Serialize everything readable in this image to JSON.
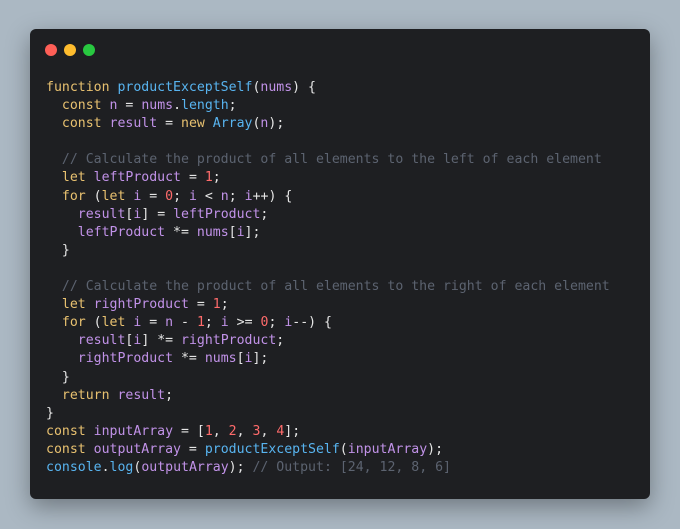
{
  "window": {
    "traffic_lights": [
      {
        "name": "close",
        "color": "#ff5f57"
      },
      {
        "name": "minimize",
        "color": "#febc2e"
      },
      {
        "name": "maximize",
        "color": "#28c840"
      }
    ]
  },
  "code": {
    "lines": [
      [
        [
          "kw",
          "function "
        ],
        [
          "fn",
          "productExceptSelf"
        ],
        [
          "pl",
          "("
        ],
        [
          "var",
          "nums"
        ],
        [
          "pl",
          ") {"
        ]
      ],
      [
        [
          "pl",
          "  "
        ],
        [
          "kw",
          "const "
        ],
        [
          "var",
          "n"
        ],
        [
          "pl",
          " = "
        ],
        [
          "var",
          "nums"
        ],
        [
          "pl",
          "."
        ],
        [
          "fn",
          "length"
        ],
        [
          "pl",
          ";"
        ]
      ],
      [
        [
          "pl",
          "  "
        ],
        [
          "kw",
          "const "
        ],
        [
          "var",
          "result"
        ],
        [
          "pl",
          " = "
        ],
        [
          "kw",
          "new "
        ],
        [
          "fn",
          "Array"
        ],
        [
          "pl",
          "("
        ],
        [
          "var",
          "n"
        ],
        [
          "pl",
          ");"
        ]
      ],
      [],
      [
        [
          "pl",
          "  "
        ],
        [
          "cm",
          "// Calculate the product of all elements to the left of each element"
        ]
      ],
      [
        [
          "pl",
          "  "
        ],
        [
          "kw",
          "let "
        ],
        [
          "var",
          "leftProduct"
        ],
        [
          "pl",
          " = "
        ],
        [
          "num",
          "1"
        ],
        [
          "pl",
          ";"
        ]
      ],
      [
        [
          "pl",
          "  "
        ],
        [
          "kw",
          "for "
        ],
        [
          "pl",
          "("
        ],
        [
          "kw",
          "let "
        ],
        [
          "var",
          "i"
        ],
        [
          "pl",
          " = "
        ],
        [
          "num",
          "0"
        ],
        [
          "pl",
          "; "
        ],
        [
          "var",
          "i"
        ],
        [
          "pl",
          " < "
        ],
        [
          "var",
          "n"
        ],
        [
          "pl",
          "; "
        ],
        [
          "var",
          "i"
        ],
        [
          "pl",
          "++) {"
        ]
      ],
      [
        [
          "pl",
          "    "
        ],
        [
          "var",
          "result"
        ],
        [
          "pl",
          "["
        ],
        [
          "var",
          "i"
        ],
        [
          "pl",
          "] = "
        ],
        [
          "var",
          "leftProduct"
        ],
        [
          "pl",
          ";"
        ]
      ],
      [
        [
          "pl",
          "    "
        ],
        [
          "var",
          "leftProduct"
        ],
        [
          "pl",
          " *= "
        ],
        [
          "var",
          "nums"
        ],
        [
          "pl",
          "["
        ],
        [
          "var",
          "i"
        ],
        [
          "pl",
          "];"
        ]
      ],
      [
        [
          "pl",
          "  }"
        ]
      ],
      [],
      [
        [
          "pl",
          "  "
        ],
        [
          "cm",
          "// Calculate the product of all elements to the right of each element"
        ]
      ],
      [
        [
          "pl",
          "  "
        ],
        [
          "kw",
          "let "
        ],
        [
          "var",
          "rightProduct"
        ],
        [
          "pl",
          " = "
        ],
        [
          "num",
          "1"
        ],
        [
          "pl",
          ";"
        ]
      ],
      [
        [
          "pl",
          "  "
        ],
        [
          "kw",
          "for "
        ],
        [
          "pl",
          "("
        ],
        [
          "kw",
          "let "
        ],
        [
          "var",
          "i"
        ],
        [
          "pl",
          " = "
        ],
        [
          "var",
          "n"
        ],
        [
          "pl",
          " - "
        ],
        [
          "num",
          "1"
        ],
        [
          "pl",
          "; "
        ],
        [
          "var",
          "i"
        ],
        [
          "pl",
          " >= "
        ],
        [
          "num",
          "0"
        ],
        [
          "pl",
          "; "
        ],
        [
          "var",
          "i"
        ],
        [
          "pl",
          "--) {"
        ]
      ],
      [
        [
          "pl",
          "    "
        ],
        [
          "var",
          "result"
        ],
        [
          "pl",
          "["
        ],
        [
          "var",
          "i"
        ],
        [
          "pl",
          "] *= "
        ],
        [
          "var",
          "rightProduct"
        ],
        [
          "pl",
          ";"
        ]
      ],
      [
        [
          "pl",
          "    "
        ],
        [
          "var",
          "rightProduct"
        ],
        [
          "pl",
          " *= "
        ],
        [
          "var",
          "nums"
        ],
        [
          "pl",
          "["
        ],
        [
          "var",
          "i"
        ],
        [
          "pl",
          "];"
        ]
      ],
      [
        [
          "pl",
          "  }"
        ]
      ],
      [
        [
          "pl",
          "  "
        ],
        [
          "kw",
          "return "
        ],
        [
          "var",
          "result"
        ],
        [
          "pl",
          ";"
        ]
      ],
      [
        [
          "pl",
          "}"
        ]
      ],
      [
        [
          "kw",
          "const "
        ],
        [
          "var",
          "inputArray"
        ],
        [
          "pl",
          " = ["
        ],
        [
          "num",
          "1"
        ],
        [
          "pl",
          ", "
        ],
        [
          "num",
          "2"
        ],
        [
          "pl",
          ", "
        ],
        [
          "num",
          "3"
        ],
        [
          "pl",
          ", "
        ],
        [
          "num",
          "4"
        ],
        [
          "pl",
          "];"
        ]
      ],
      [
        [
          "kw",
          "const "
        ],
        [
          "var",
          "outputArray"
        ],
        [
          "pl",
          " = "
        ],
        [
          "fn",
          "productExceptSelf"
        ],
        [
          "pl",
          "("
        ],
        [
          "var",
          "inputArray"
        ],
        [
          "pl",
          ");"
        ]
      ],
      [
        [
          "fn",
          "console"
        ],
        [
          "pl",
          "."
        ],
        [
          "fn",
          "log"
        ],
        [
          "pl",
          "("
        ],
        [
          "var",
          "outputArray"
        ],
        [
          "pl",
          "); "
        ],
        [
          "cm",
          "// Output: [24, 12, 8, 6]"
        ]
      ]
    ]
  }
}
